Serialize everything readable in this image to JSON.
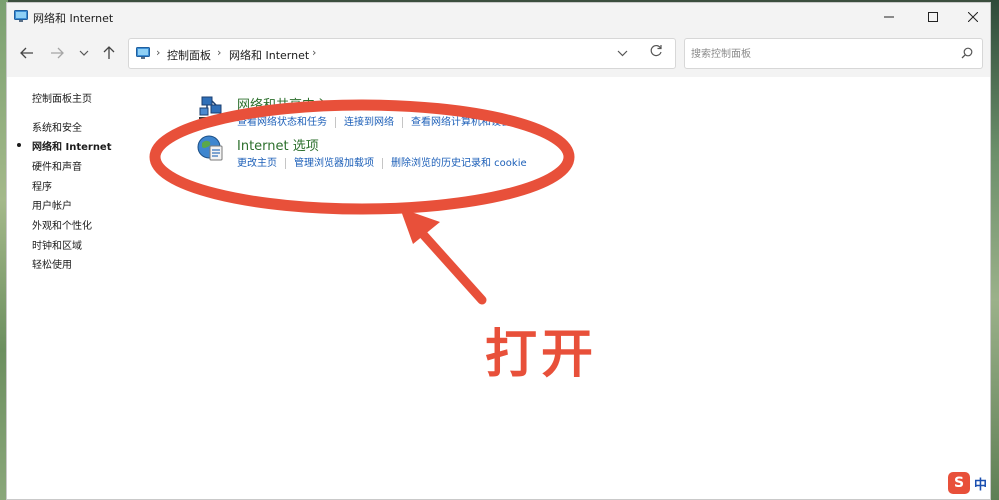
{
  "window": {
    "title": "网络和 Internet",
    "minimize_icon": "minimize-icon",
    "maximize_icon": "maximize-icon",
    "close_icon": "close-icon"
  },
  "navigation": {
    "back_icon": "back-arrow-icon",
    "forward_icon": "forward-arrow-icon",
    "recent_icon": "chevron-down-icon",
    "up_icon": "up-arrow-icon"
  },
  "address_bar": {
    "breadcrumbs": [
      "控制面板",
      "网络和 Internet"
    ],
    "separator": "›",
    "dropdown_icon": "chevron-down-icon",
    "refresh_icon": "refresh-icon"
  },
  "search": {
    "placeholder": "搜索控制面板",
    "value": "",
    "icon": "search-icon"
  },
  "sidebar": {
    "items": [
      {
        "label": "控制面板主页",
        "active": false
      },
      {
        "label": "系统和安全",
        "active": false
      },
      {
        "label": "网络和 Internet",
        "active": true
      },
      {
        "label": "硬件和声音",
        "active": false
      },
      {
        "label": "程序",
        "active": false
      },
      {
        "label": "用户帐户",
        "active": false
      },
      {
        "label": "外观和个性化",
        "active": false
      },
      {
        "label": "时钟和区域",
        "active": false
      },
      {
        "label": "轻松使用",
        "active": false
      }
    ]
  },
  "main": {
    "groups": [
      {
        "title": "网络和共享中心",
        "icon": "network-sharing-icon",
        "links": [
          "查看网络状态和任务",
          "连接到网络",
          "查看网络计算机和设备"
        ]
      },
      {
        "title": "Internet 选项",
        "icon": "internet-options-globe-icon",
        "links": [
          "更改主页",
          "管理浏览器加载项",
          "删除浏览的历史记录和 cookie"
        ]
      }
    ]
  },
  "annotation": {
    "text": "打开",
    "color": "#e8503a",
    "shapes": [
      "ellipse-highlight",
      "arrow"
    ]
  },
  "tray": {
    "ime_icon": "sogou-ime-icon",
    "ime_letter": "S",
    "ime_language": "中"
  }
}
